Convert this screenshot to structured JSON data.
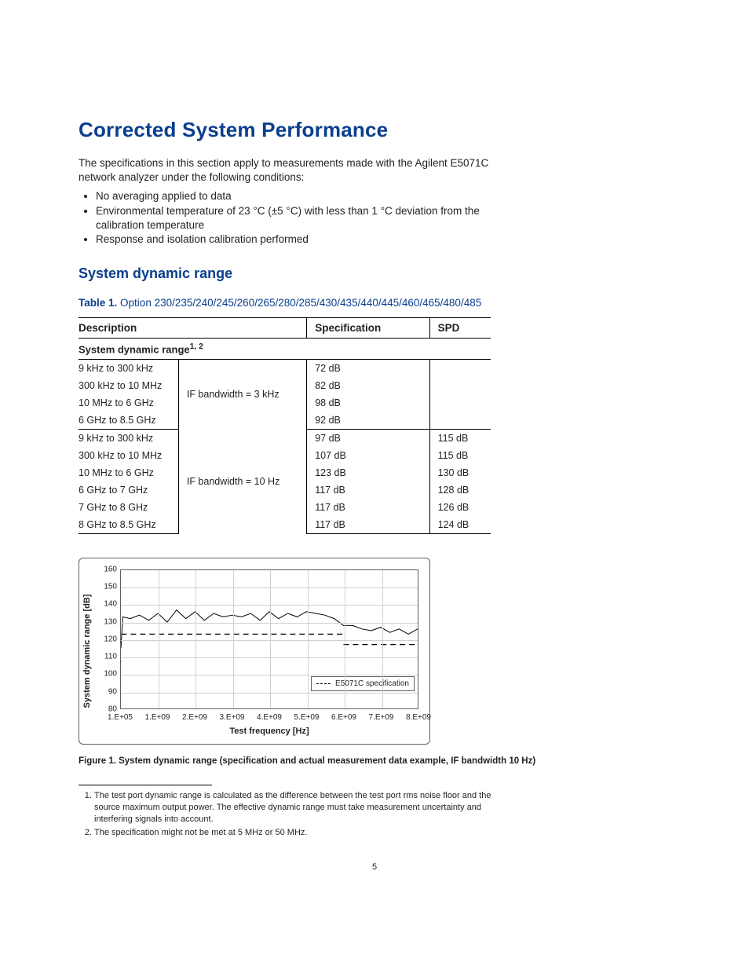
{
  "title": "Corrected System Performance",
  "intro": "The specifications in this section apply to measurements made with the Agilent E5071C network analyzer under the following conditions:",
  "bullets": [
    "No averaging applied to data",
    "Environmental temperature of 23 °C (±5 °C) with less than 1 °C deviation from the calibration temperature",
    "Response and isolation calibration performed"
  ],
  "subsection": "System dynamic range",
  "table_label": "Table 1.",
  "table_caption": "Option 230/235/240/245/260/265/280/285/430/435/440/445/460/465/480/485",
  "columns": {
    "desc": "Description",
    "spec": "Specification",
    "spd": "SPD"
  },
  "subheader": {
    "text": "System dynamic range",
    "sup": "1, 2"
  },
  "group1_bw": "IF bandwidth = 3 kHz",
  "group2_bw": "IF bandwidth = 10 Hz",
  "rows1": [
    {
      "desc": "9 kHz to 300 kHz",
      "spec": "72 dB",
      "spd": ""
    },
    {
      "desc": "300 kHz to 10 MHz",
      "spec": "82 dB",
      "spd": ""
    },
    {
      "desc": "10 MHz to 6 GHz",
      "spec": "98 dB",
      "spd": ""
    },
    {
      "desc": "6 GHz to 8.5 GHz",
      "spec": "92 dB",
      "spd": ""
    }
  ],
  "rows2": [
    {
      "desc": "9 kHz to 300 kHz",
      "spec": "97 dB",
      "spd": "115 dB"
    },
    {
      "desc": "300 kHz to 10 MHz",
      "spec": "107 dB",
      "spd": "115 dB"
    },
    {
      "desc": "10 MHz to 6 GHz",
      "spec": "123 dB",
      "spd": "130 dB"
    },
    {
      "desc": "6 GHz to 7 GHz",
      "spec": "117 dB",
      "spd": "128 dB"
    },
    {
      "desc": "7 GHz to 8 GHz",
      "spec": "117 dB",
      "spd": "126 dB"
    },
    {
      "desc": "8 GHz to 8.5 GHz",
      "spec": "117 dB",
      "spd": "124 dB"
    }
  ],
  "chart_caption": "Figure 1. System dynamic range (specification and actual measurement data example, IF bandwidth 10 Hz)",
  "footnotes": [
    "The test port dynamic range is calculated as the difference between the test port rms noise floor and the source maximum output power. The effective dynamic range must take measurement uncertainty and interfering signals into account.",
    "The specification might not be met at 5 MHz or  50 MHz."
  ],
  "page_number": "5",
  "chart_data": {
    "type": "line",
    "xlabel": "Test frequency [Hz]",
    "ylabel": "System dynamic range [dB]",
    "ylim": [
      80,
      160
    ],
    "yticks": [
      80,
      90,
      100,
      110,
      120,
      130,
      140,
      150,
      160
    ],
    "xticks": [
      "1.E+05",
      "1.E+09",
      "2.E+09",
      "3.E+09",
      "4.E+09",
      "5.E+09",
      "6.E+09",
      "7.E+09",
      "8.E+09"
    ],
    "legend": "E5071C specification",
    "series": [
      {
        "name": "E5071C specification",
        "style": "dashed",
        "segments": [
          {
            "x": [
              100000.0,
              300000.0
            ],
            "y": [
              97,
              97
            ]
          },
          {
            "x": [
              300000.0,
              10000000.0
            ],
            "y": [
              107,
              107
            ]
          },
          {
            "x": [
              10000000.0,
              6000000000.0
            ],
            "y": [
              123,
              123
            ]
          },
          {
            "x": [
              6000000000.0,
              8500000000.0
            ],
            "y": [
              117,
              117
            ]
          }
        ]
      },
      {
        "name": "Measured",
        "style": "solid",
        "x": [
          100000.0,
          50000000.0,
          250000000.0,
          500000000.0,
          750000000.0,
          1000000000.0,
          1250000000.0,
          1500000000.0,
          1750000000.0,
          2000000000.0,
          2250000000.0,
          2500000000.0,
          2750000000.0,
          3000000000.0,
          3250000000.0,
          3500000000.0,
          3750000000.0,
          4000000000.0,
          4250000000.0,
          4500000000.0,
          4750000000.0,
          5000000000.0,
          5250000000.0,
          5500000000.0,
          5750000000.0,
          6000000000.0,
          6250000000.0,
          6500000000.0,
          6750000000.0,
          7000000000.0,
          7250000000.0,
          7500000000.0,
          7750000000.0,
          8000000000.0,
          8250000000.0,
          8500000000.0
        ],
        "y": [
          115,
          133,
          132,
          134,
          131,
          135,
          130,
          137,
          132,
          136,
          131,
          135,
          133,
          134,
          133,
          135,
          131,
          136,
          132,
          135,
          133,
          136,
          135,
          134,
          132,
          128,
          128,
          126,
          125,
          127,
          124,
          126,
          123,
          126,
          123,
          125
        ]
      }
    ]
  }
}
